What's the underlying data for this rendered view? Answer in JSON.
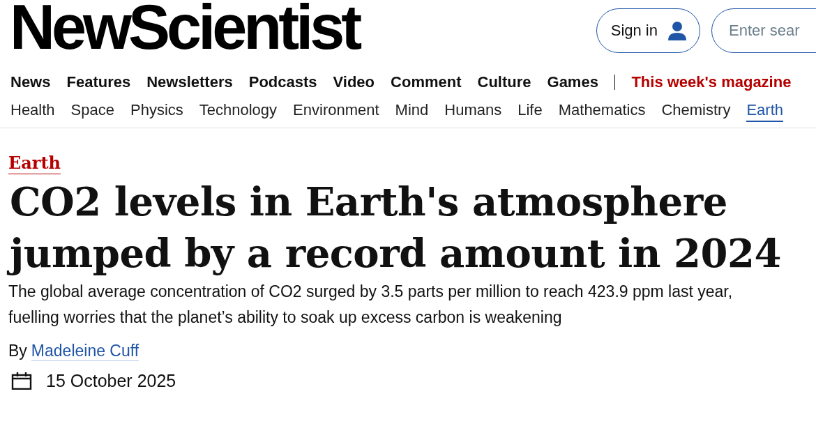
{
  "header": {
    "logo": "NewScientist",
    "sign_in": "Sign in",
    "search": {
      "placeholder": "Enter sear"
    }
  },
  "main_nav": [
    {
      "label": "News",
      "highlight": false
    },
    {
      "label": "Features",
      "highlight": false
    },
    {
      "label": "Newsletters",
      "highlight": false
    },
    {
      "label": "Podcasts",
      "highlight": false
    },
    {
      "label": "Video",
      "highlight": false
    },
    {
      "label": "Comment",
      "highlight": false
    },
    {
      "label": "Culture",
      "highlight": false
    },
    {
      "label": "Games",
      "highlight": false
    },
    {
      "label": "This week's magazine",
      "highlight": true
    }
  ],
  "topic_nav": [
    {
      "label": "Health",
      "selected": false
    },
    {
      "label": "Space",
      "selected": false
    },
    {
      "label": "Physics",
      "selected": false
    },
    {
      "label": "Technology",
      "selected": false
    },
    {
      "label": "Environment",
      "selected": false
    },
    {
      "label": "Mind",
      "selected": false
    },
    {
      "label": "Humans",
      "selected": false
    },
    {
      "label": "Life",
      "selected": false
    },
    {
      "label": "Mathematics",
      "selected": false
    },
    {
      "label": "Chemistry",
      "selected": false
    },
    {
      "label": "Earth",
      "selected": true
    }
  ],
  "article": {
    "section": "Earth",
    "headline": "CO2 levels in Earth's atmosphere jumped by a record amount in 2024",
    "standfirst": "The global average concentration of CO2 surged by 3.5 parts per million to reach 423.9 ppm last year, fuelling worries that the planet’s ability to soak up excess carbon is weakening",
    "byline_prefix": "By",
    "author": "Madeleine Cuff",
    "date": "15 October 2025"
  }
}
